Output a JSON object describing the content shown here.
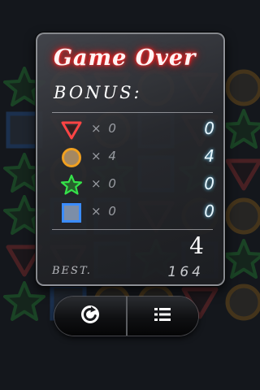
{
  "dialog": {
    "title": "Game Over",
    "bonus_label": "BONUS:",
    "rows": [
      {
        "icon": "triangle-icon",
        "count_label": "× 0",
        "points": "0",
        "color": "#ff4444"
      },
      {
        "icon": "circle-icon",
        "count_label": "× 4",
        "points": "4",
        "color": "#f0a020"
      },
      {
        "icon": "star-icon",
        "count_label": "× 0",
        "points": "0",
        "color": "#35e24a"
      },
      {
        "icon": "square-icon",
        "count_label": "× 0",
        "points": "0",
        "color": "#3a8cff"
      }
    ],
    "score": "4",
    "best_label": "BEST.",
    "best_value": "164"
  },
  "buttons": {
    "restart_icon": "restart-icon",
    "menu_icon": "menu-list-icon"
  },
  "colors": {
    "title_glow": "#ff2020",
    "points_glow": "#6cd2ff",
    "background": "#1b1e22"
  }
}
